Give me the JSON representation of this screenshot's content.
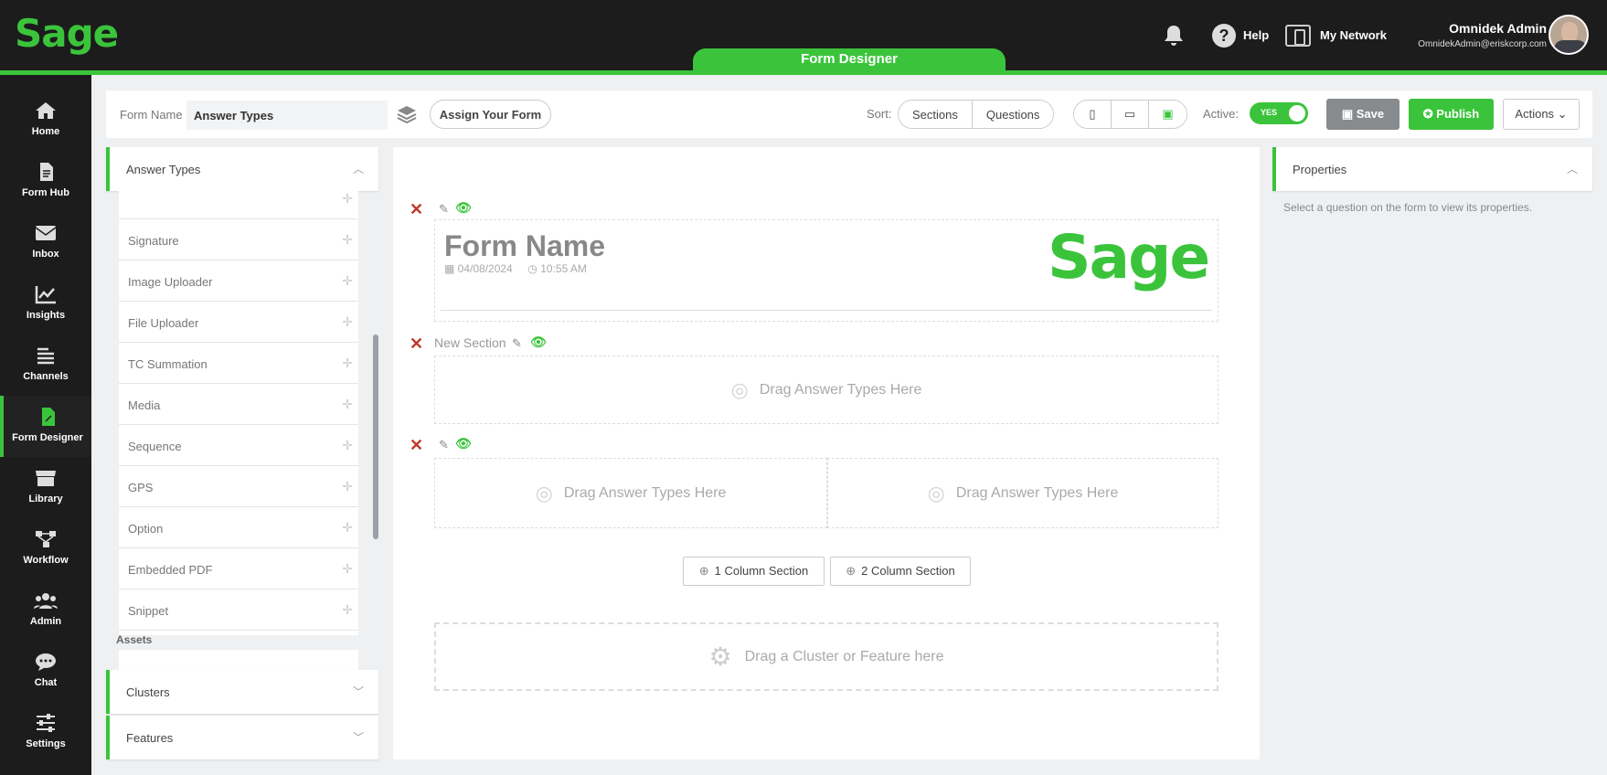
{
  "app": {
    "logo": "Sage",
    "active_tab": "Form Designer"
  },
  "header": {
    "help_label": "Help",
    "network_label": "My Network",
    "user_name": "Omnidek Admin",
    "user_email": "OmnidekAdmin@eriskcorp.com"
  },
  "sidebar": {
    "items": [
      {
        "label": "Home",
        "icon": "home-icon"
      },
      {
        "label": "Form Hub",
        "icon": "document-icon"
      },
      {
        "label": "Inbox",
        "icon": "envelope-icon"
      },
      {
        "label": "Insights",
        "icon": "chart-icon"
      },
      {
        "label": "Channels",
        "icon": "list-icon"
      },
      {
        "label": "Form Designer",
        "icon": "form-edit-icon",
        "active": true
      },
      {
        "label": "Library",
        "icon": "store-icon"
      },
      {
        "label": "Workflow",
        "icon": "workflow-icon"
      },
      {
        "label": "Admin",
        "icon": "users-icon"
      },
      {
        "label": "Chat",
        "icon": "chat-icon"
      },
      {
        "label": "Settings",
        "icon": "sliders-icon"
      }
    ]
  },
  "toolbar": {
    "form_name_label": "Form Name",
    "form_name_value": "Answer Types",
    "assign_label": "Assign Your Form",
    "sort_label": "Sort:",
    "sort_sections": "Sections",
    "sort_questions": "Questions",
    "active_label": "Active:",
    "toggle_text": "YES",
    "save_label": "Save",
    "publish_label": "Publish",
    "actions_label": "Actions"
  },
  "left_panel": {
    "title": "Answer Types",
    "items": [
      "Signature",
      "Image Uploader",
      "File Uploader",
      "TC Summation",
      "Media",
      "Sequence",
      "GPS",
      "Option",
      "Embedded PDF",
      "Snippet"
    ],
    "assets_label": "Assets",
    "clusters_title": "Clusters",
    "features_title": "Features"
  },
  "canvas": {
    "form_title": "Form Name",
    "date": "04/08/2024",
    "time": "10:55 AM",
    "logo": "Sage",
    "new_section_label": "New Section",
    "drag_answer_text": "Drag Answer Types Here",
    "one_column_label": "1 Column Section",
    "two_column_label": "2 Column Section",
    "cluster_drop_text": "Drag a Cluster or Feature here"
  },
  "properties": {
    "title": "Properties",
    "help_text": "Select a question on the form to view its properties."
  },
  "colors": {
    "accent": "#3bc43b",
    "topbar": "#1c1c1c",
    "danger": "#c0392b"
  }
}
